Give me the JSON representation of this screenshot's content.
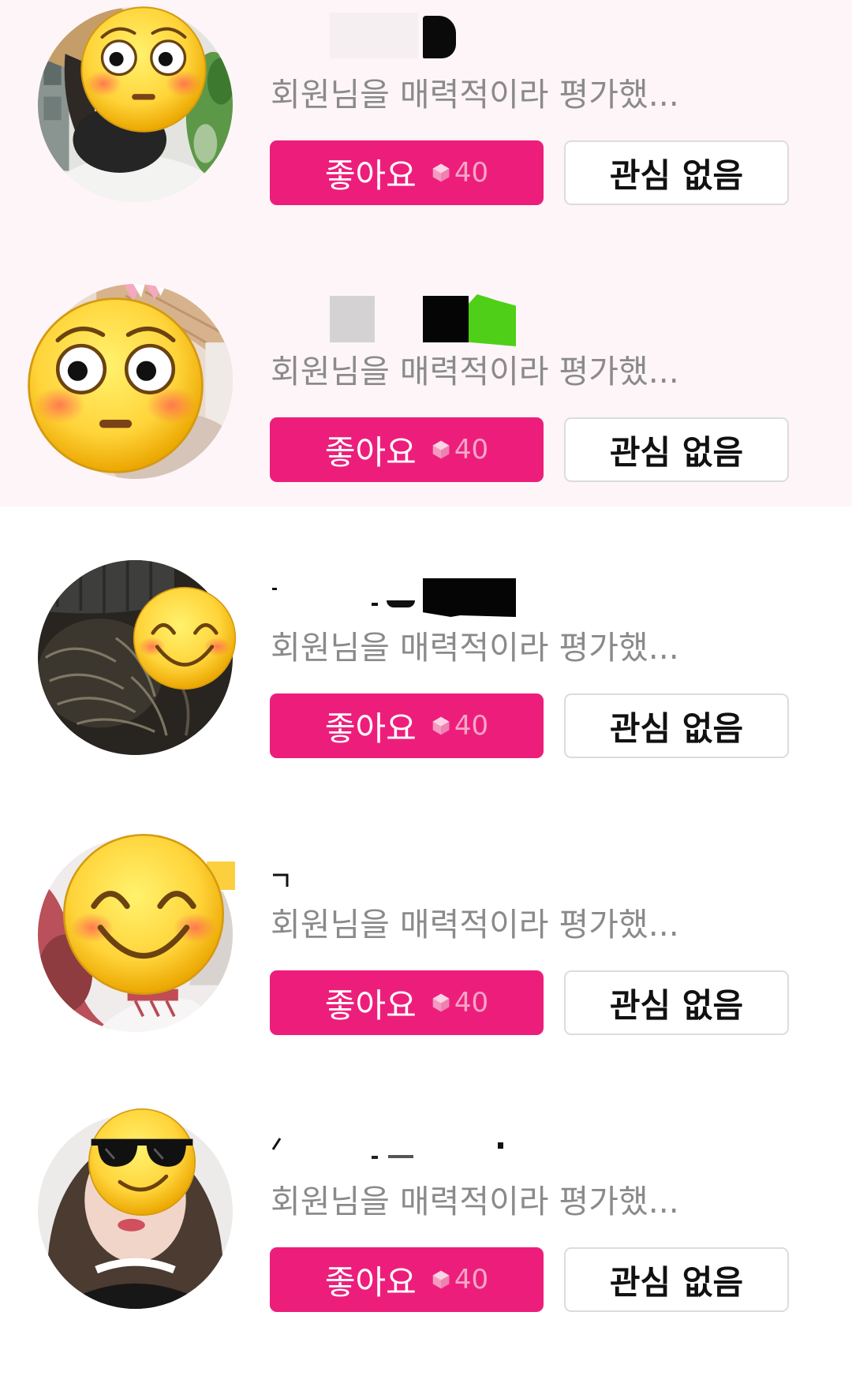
{
  "colors": {
    "like_button_bg": "#ed1e7b",
    "like_button_text": "#ffffff",
    "gem_color": "#f6a6c8",
    "pass_button_border": "#dcdcdc",
    "message_text": "#8a8a8a",
    "unread_bg": "#fdf5f8"
  },
  "items": [
    {
      "highlighted": true,
      "avatar_sticker": "flushed-face",
      "message": "회원님을 매력적이라 평가했...",
      "like_label": "좋아요",
      "like_cost_icon": "gem-icon",
      "like_cost": "40",
      "pass_label": "관심 없음"
    },
    {
      "highlighted": true,
      "avatar_sticker": "flushed-face",
      "message": "회원님을 매력적이라 평가했...",
      "like_label": "좋아요",
      "like_cost_icon": "gem-icon",
      "like_cost": "40",
      "pass_label": "관심 없음"
    },
    {
      "highlighted": false,
      "avatar_sticker": "smiling-face",
      "message": "회원님을 매력적이라 평가했...",
      "like_label": "좋아요",
      "like_cost_icon": "gem-icon",
      "like_cost": "40",
      "pass_label": "관심 없음"
    },
    {
      "highlighted": false,
      "avatar_sticker": "smiling-face",
      "message": "회원님을 매력적이라 평가했...",
      "like_label": "좋아요",
      "like_cost_icon": "gem-icon",
      "like_cost": "40",
      "pass_label": "관심 없음"
    },
    {
      "highlighted": false,
      "avatar_sticker": "sunglasses-face",
      "message": "회원님을 매력적이라 평가했...",
      "like_label": "좋아요",
      "like_cost_icon": "gem-icon",
      "like_cost": "40",
      "pass_label": "관심 없음"
    }
  ]
}
